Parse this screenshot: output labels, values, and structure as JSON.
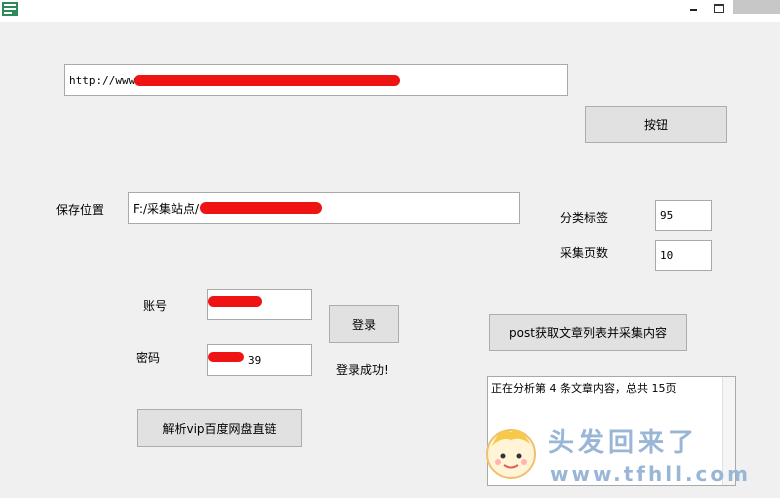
{
  "window": {
    "icon": "app-icon",
    "controls": [
      "minimize-icon",
      "maximize-icon",
      "close-icon"
    ]
  },
  "url_field": {
    "value": "http://www."
  },
  "main_button": {
    "label": "按钮"
  },
  "save": {
    "label": "保存位置",
    "value_prefix": "F:/采集站点/"
  },
  "category": {
    "label": "分类标签",
    "value": "95"
  },
  "pages": {
    "label": "采集页数",
    "value": "10"
  },
  "account": {
    "label": "账号"
  },
  "password": {
    "label": "密码",
    "value_tail": "39"
  },
  "login": {
    "label": "登录",
    "status": "登录成功!"
  },
  "post_button": {
    "label": "post获取文章列表并采集内容"
  },
  "parse_button": {
    "label": "解析vip百度网盘直链"
  },
  "log": {
    "text": "正在分析第 4 条文章内容，总共 15页"
  },
  "watermark": {
    "text": "头发回来了",
    "url": "www.tfhll.com"
  }
}
